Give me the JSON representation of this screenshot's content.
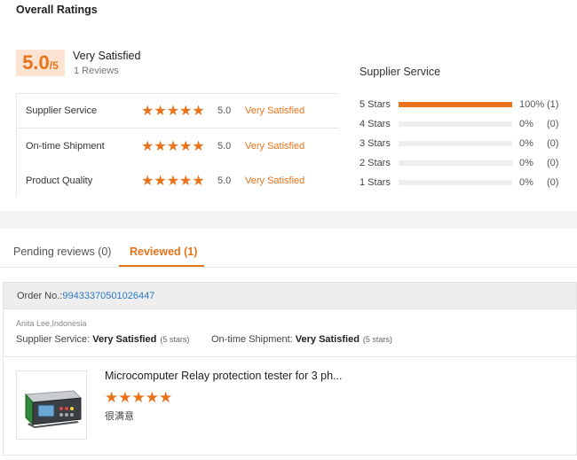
{
  "overall": {
    "title": "Overall Ratings",
    "score": "5.0",
    "score_max": "/5",
    "label": "Very Satisfied",
    "count": "1 Reviews"
  },
  "ratings": [
    {
      "name": "Supplier Service",
      "stars": "★★★★★",
      "value": "5.0",
      "text": "Very Satisfied"
    },
    {
      "name": "On-time Shipment",
      "stars": "★★★★★",
      "value": "5.0",
      "text": "Very Satisfied"
    },
    {
      "name": "Product Quality",
      "stars": "★★★★★",
      "value": "5.0",
      "text": "Very Satisfied"
    }
  ],
  "supplier_breakdown": {
    "title": "Supplier Service",
    "rows": [
      {
        "label": "5 Stars",
        "fraction": 1.0,
        "pct": "100%",
        "count": "(1)"
      },
      {
        "label": "4 Stars",
        "fraction": 0.0,
        "pct": "0%",
        "count": "(0)"
      },
      {
        "label": "3 Stars",
        "fraction": 0.0,
        "pct": "0%",
        "count": "(0)"
      },
      {
        "label": "2 Stars",
        "fraction": 0.0,
        "pct": "0%",
        "count": "(0)"
      },
      {
        "label": "1 Stars",
        "fraction": 0.0,
        "pct": "0%",
        "count": "(0)"
      }
    ]
  },
  "tabs": {
    "pending": "Pending reviews (0)",
    "reviewed": "Reviewed (1)"
  },
  "order": {
    "label": "Order No.: ",
    "number": "99433370501026447"
  },
  "review": {
    "reviewer": "Anita Lee,Indonesia",
    "supplier_label": "Supplier Service: ",
    "supplier_value": "Very Satisfied",
    "supplier_stars": "(5 stars)",
    "shipment_label": "On-time Shipment: ",
    "shipment_value": "Very Satisfied",
    "shipment_stars": "(5 stars)",
    "product_title": "Microcomputer Relay protection tester for 3 ph...",
    "product_stars": "★★★★★",
    "comment": "很满意"
  },
  "colors": {
    "accent": "#e8731a",
    "link": "#2a79c5"
  }
}
